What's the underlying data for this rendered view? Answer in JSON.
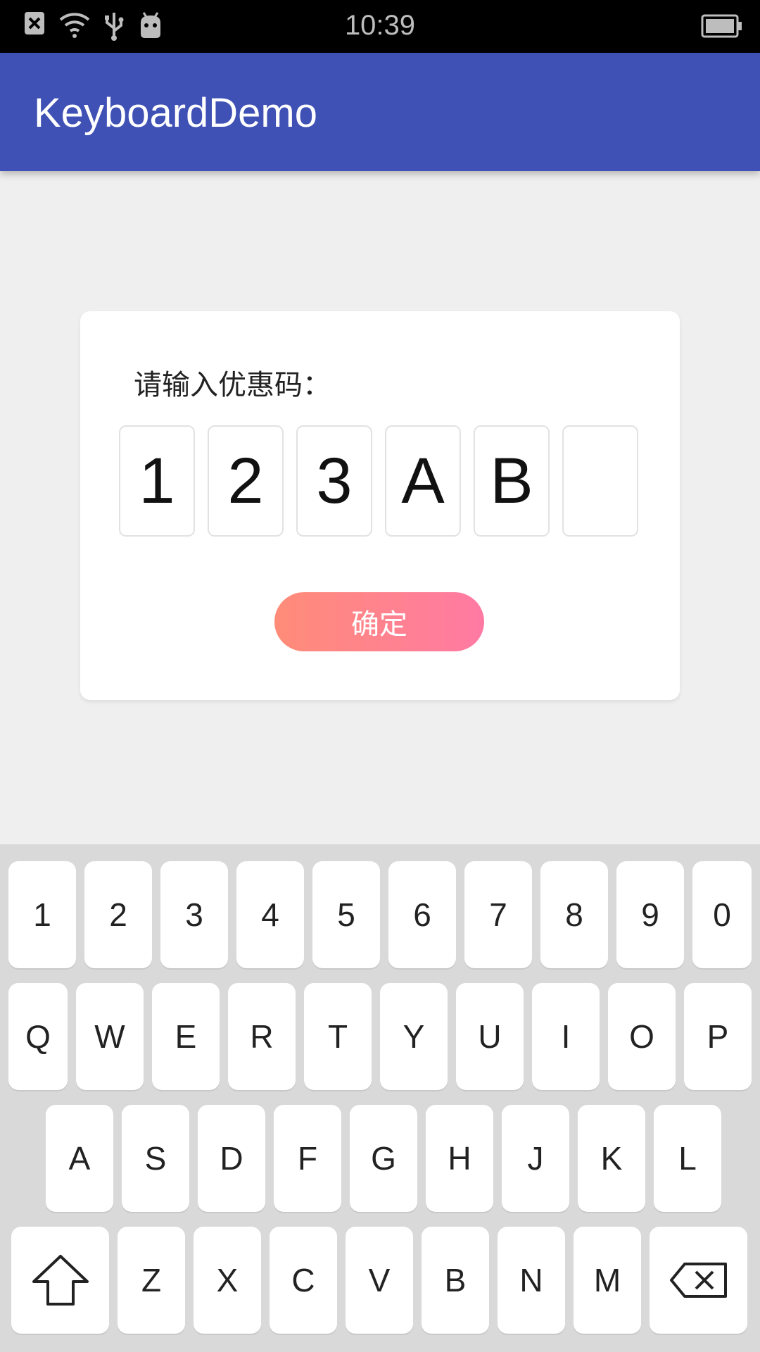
{
  "status_bar": {
    "time": "10:39",
    "left_icons": [
      "notification-x-icon",
      "wifi-icon",
      "usb-icon",
      "android-icon"
    ],
    "battery_icon": "battery-icon"
  },
  "app_bar": {
    "title": "KeyboardDemo"
  },
  "card": {
    "prompt": "请输入优惠码：",
    "code_values": [
      "1",
      "2",
      "3",
      "A",
      "B",
      ""
    ],
    "confirm_label": "确定",
    "confirm_gradient": [
      "#ff8c78",
      "#ff7aa3"
    ]
  },
  "keyboard": {
    "row1": [
      "1",
      "2",
      "3",
      "4",
      "5",
      "6",
      "7",
      "8",
      "9",
      "0"
    ],
    "row2": [
      "Q",
      "W",
      "E",
      "R",
      "T",
      "Y",
      "U",
      "I",
      "O",
      "P"
    ],
    "row3": [
      "A",
      "S",
      "D",
      "F",
      "G",
      "H",
      "J",
      "K",
      "L"
    ],
    "row4": [
      "Z",
      "X",
      "C",
      "V",
      "B",
      "N",
      "M"
    ],
    "shift_icon": "shift-arrow-icon",
    "backspace_icon": "backspace-icon"
  },
  "colors": {
    "app_bar": "#3f51b5",
    "background": "#efefef",
    "keyboard_bg": "#d9d9d9"
  }
}
